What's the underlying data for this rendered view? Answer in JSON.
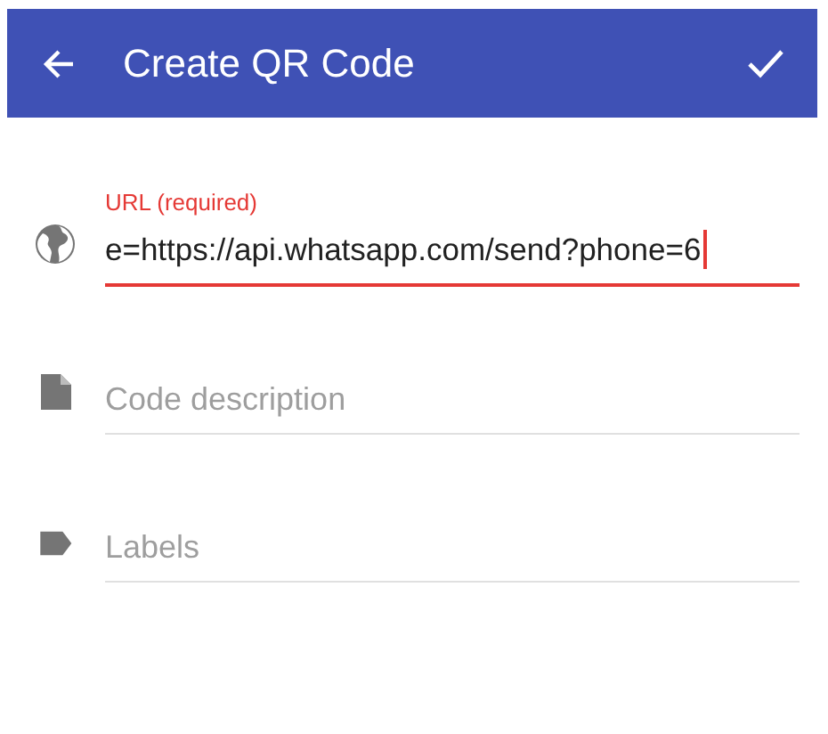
{
  "app_bar": {
    "title": "Create QR Code"
  },
  "fields": [
    {
      "kind": "url",
      "label": "URL (required)",
      "value": "e=https://api.whatsapp.com/send?phone=6",
      "focused": true,
      "error": true
    },
    {
      "kind": "description",
      "placeholder": "Code description",
      "focused": false,
      "error": false
    },
    {
      "kind": "labels",
      "placeholder": "Labels",
      "focused": false,
      "error": false
    }
  ]
}
